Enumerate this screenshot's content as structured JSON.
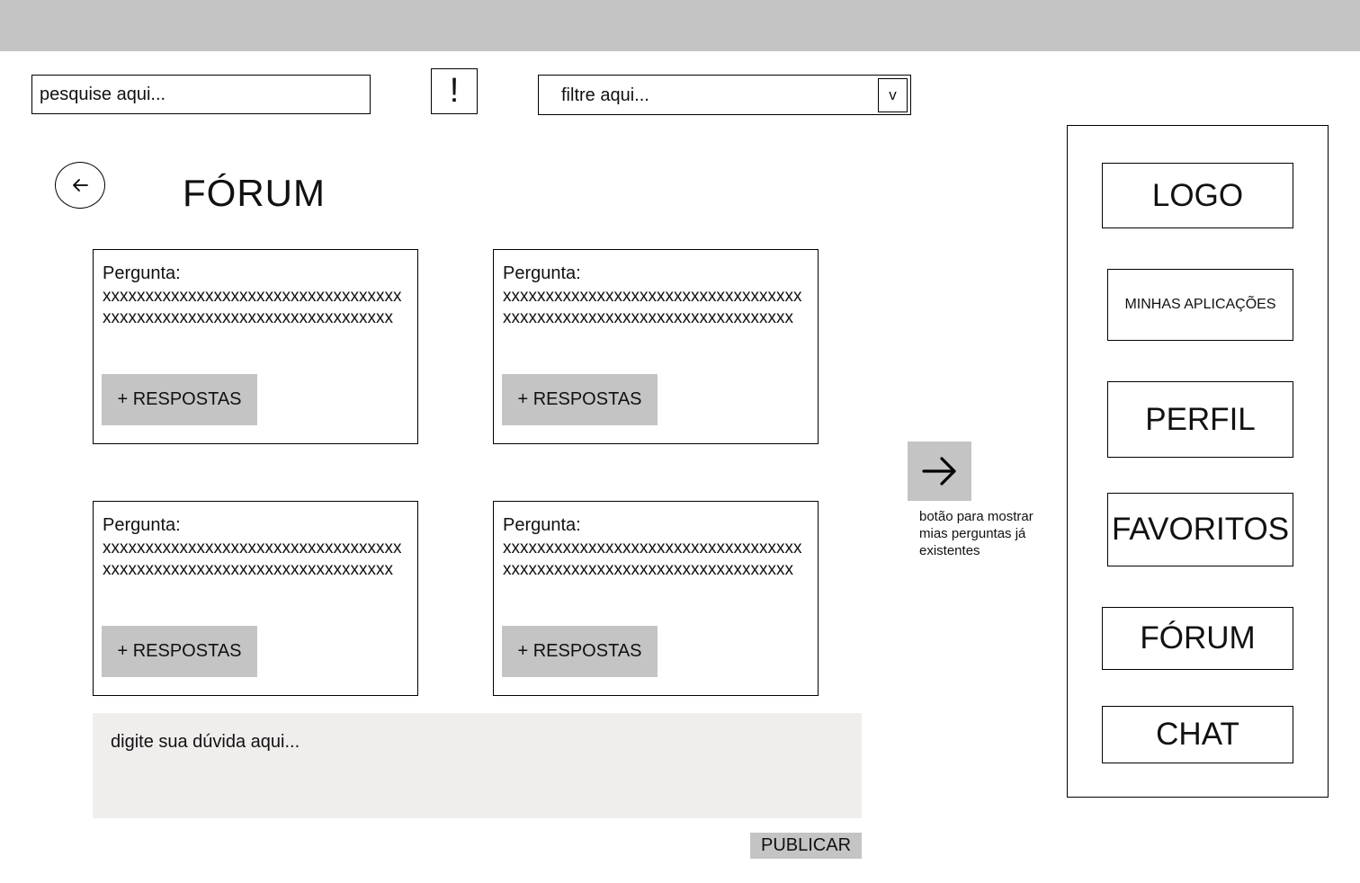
{
  "search": {
    "placeholder": "pesquise aqui..."
  },
  "alert": {
    "label": "!"
  },
  "filter": {
    "placeholder": "filtre aqui...",
    "caret": "v"
  },
  "header": {
    "back_icon": "arrow-left-icon",
    "title": "FÓRUM"
  },
  "questions": [
    {
      "label": "Pergunta:",
      "text": "xxxxxxxxxxxxxxxxxxxxxxxxxxxxxxxxxxxxxxxxxxxxxxxxxxxxxxxxxxxxxxxxxxxxx",
      "button": "+ RESPOSTAS"
    },
    {
      "label": "Pergunta:",
      "text": "xxxxxxxxxxxxxxxxxxxxxxxxxxxxxxxxxxxxxxxxxxxxxxxxxxxxxxxxxxxxxxxxxxxxx",
      "button": "+ RESPOSTAS"
    },
    {
      "label": "Pergunta:",
      "text": "xxxxxxxxxxxxxxxxxxxxxxxxxxxxxxxxxxxxxxxxxxxxxxxxxxxxxxxxxxxxxxxxxxxxx",
      "button": "+ RESPOSTAS"
    },
    {
      "label": "Pergunta:",
      "text": "xxxxxxxxxxxxxxxxxxxxxxxxxxxxxxxxxxxxxxxxxxxxxxxxxxxxxxxxxxxxxxxxxxxxx",
      "button": "+ RESPOSTAS"
    }
  ],
  "next": {
    "icon": "arrow-right-icon",
    "caption": "botão para mostrar mias perguntas já existentes"
  },
  "composer": {
    "placeholder": "digite sua dúvida aqui...",
    "publish_label": "PUBLICAR"
  },
  "sidebar": {
    "items": [
      {
        "label": "LOGO"
      },
      {
        "label": "MINHAS APLICAÇÕES"
      },
      {
        "label": "PERFIL"
      },
      {
        "label": "FAVORITOS"
      },
      {
        "label": "FÓRUM"
      },
      {
        "label": "CHAT"
      }
    ]
  },
  "colors": {
    "topbar": "#c4c4c4",
    "button_bg": "#c4c4c4",
    "composer_bg": "#f1eded",
    "border": "#000000"
  }
}
